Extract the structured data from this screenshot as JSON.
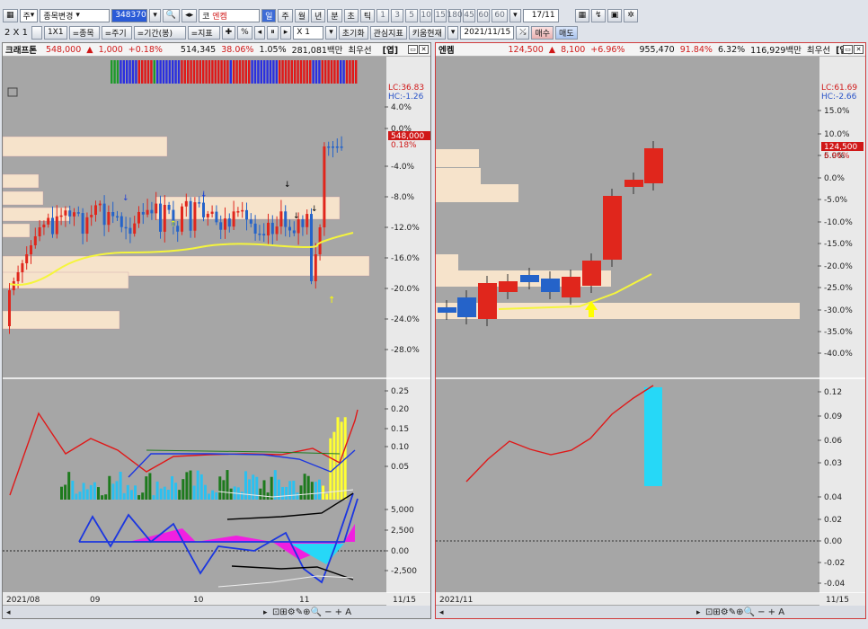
{
  "toolbar1": {
    "period": "주",
    "stock_change": "종목변경",
    "code": "348370",
    "name_prefix": "코",
    "stock_name": "엔켐",
    "period_tabs": [
      "일",
      "주",
      "월",
      "년",
      "분",
      "초",
      "틱"
    ],
    "interval_tabs": [
      "1",
      "3",
      "5",
      "10",
      "15",
      "180",
      "45",
      "60",
      "60"
    ],
    "count": "17/11"
  },
  "toolbar2": {
    "layout": "2 X 1",
    "one_by_one": "1X1",
    "items": [
      "=종목",
      "=주기",
      "=기간(봉)",
      "=지표"
    ],
    "percent": "%",
    "zoom": "X 1",
    "reset": "초기화",
    "interest": "관심지표",
    "key_current": "키움현재",
    "date": "2021/11/15",
    "buy": "매수",
    "sell": "매도"
  },
  "left": {
    "name": "크래프톤",
    "price": "548,000",
    "change": "1,000",
    "pct": "+0.18%",
    "volume": "514,345",
    "ratio": "38.06%",
    "turnover": "1.05%",
    "amount": "281,081백만",
    "priority": "최우선",
    "tag": "[엽]",
    "lc": "LC:36.83",
    "hc": "HC:-1.26",
    "price_tag": "548,000",
    "price_pct": "0.18%",
    "y_labels": [
      "4.0%",
      "0.0%",
      "-4.0%",
      "-8.0%",
      "-12.0%",
      "-16.0%",
      "-20.0%",
      "-24.0%",
      "-28.0%"
    ],
    "ind1_labels": [
      "0.25",
      "0.20",
      "0.15",
      "0.10",
      "0.05"
    ],
    "ind2_labels": [
      "5,000",
      "2,500",
      "0.00",
      "-2,500"
    ],
    "x_labels": [
      "2021/08",
      "09",
      "10",
      "11"
    ],
    "x_last": "11/15"
  },
  "right": {
    "name": "엔켐",
    "price": "124,500",
    "change": "8,100",
    "pct": "+6.96%",
    "volume": "955,470",
    "ratio": "91.84%",
    "turnover": "6.32%",
    "amount": "116,929백만",
    "priority": "최우선",
    "tag": "[엽]",
    "lc": "LC:61.69",
    "hc": "HC:-2.66",
    "price_tag": "124,500",
    "price_pct": "6.96%",
    "y_labels": [
      "15.0%",
      "10.0%",
      "5.0%",
      "0.0%",
      "-5.0%",
      "-10.0%",
      "-15.0%",
      "-20.0%",
      "-25.0%",
      "-30.0%",
      "-35.0%",
      "-40.0%"
    ],
    "ind1_labels": [
      "0.12",
      "0.09",
      "0.06",
      "0.03"
    ],
    "ind2_labels": [
      "0.04",
      "0.02",
      "0.00",
      "-0.02",
      "-0.04"
    ],
    "x_labels": [
      "2021/11"
    ],
    "x_last": "11/15"
  },
  "colors": {
    "up": "#e0261c",
    "down": "#2563c9",
    "ma": "#f5f53c",
    "box": "#f6e3cb",
    "bg": "#a6a6a6"
  }
}
